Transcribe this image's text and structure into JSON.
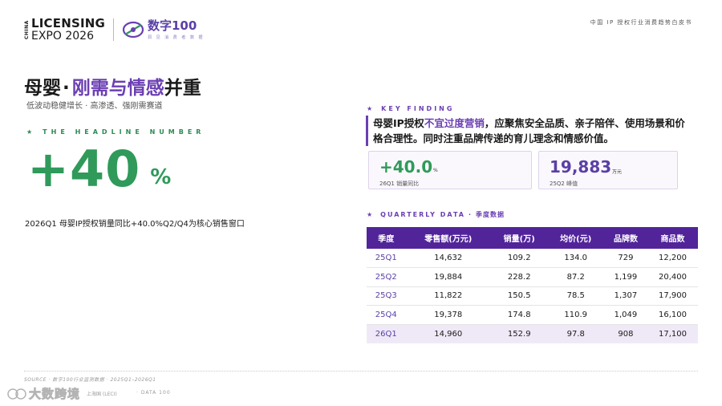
{
  "header": {
    "logo_vertical": "CHINA",
    "logo_line1": "LICENSING",
    "logo_line2": "EXPO 2026",
    "brand_name": "数字100",
    "brand_sub": "洞 见 消 费 者 数 据",
    "report_title": "中国 IP 授权行业消费趋势白皮书"
  },
  "title": {
    "prefix": "母婴",
    "dot": "·",
    "highlight": "刚需与情感",
    "suffix": "并重"
  },
  "subtitle": "低波动稳健增长  ·  高渗透、强刚需赛道",
  "headline": {
    "label_star": "★",
    "label": "THE HEADLINE NUMBER",
    "value": "+40",
    "unit": "%",
    "caption": "2026Q1  母婴IP授权销量同比+40.0%Q2/Q4为核心销售窗口"
  },
  "key_finding": {
    "label_star": "★",
    "label": "KEY FINDING",
    "text_part1": "母婴IP授权",
    "text_highlight": "不宜过度营销",
    "text_part2": "，应聚焦安全品质、亲子陪伴、使用场景和价格合理性。同时注重品牌传递的育儿理念和情感价值。"
  },
  "cards": [
    {
      "value": "+40.0",
      "unit": "%",
      "caption": "26Q1 销量同比"
    },
    {
      "value": "19,883",
      "unit": "万元",
      "caption": "25Q2 峰值"
    }
  ],
  "quarterly": {
    "label_star": "★",
    "label": "QUARTERLY DATA",
    "sep": "·",
    "label_cn": "季度数据",
    "headers": [
      "季度",
      "零售额(万元)",
      "销量(万)",
      "均价(元)",
      "品牌数",
      "商品数"
    ],
    "rows": [
      [
        "25Q1",
        "14,632",
        "109.2",
        "134.0",
        "729",
        "12,200"
      ],
      [
        "25Q2",
        "19,884",
        "228.2",
        "87.2",
        "1,199",
        "20,400"
      ],
      [
        "25Q3",
        "11,822",
        "150.5",
        "78.5",
        "1,307",
        "17,900"
      ],
      [
        "25Q4",
        "19,378",
        "174.8",
        "110.9",
        "1,049",
        "16,100"
      ],
      [
        "26Q1",
        "14,960",
        "152.9",
        "97.8",
        "908",
        "17,100"
      ]
    ]
  },
  "footer": {
    "source": "SOURCE · 数字100行业监测数据 · 2025Q1–2026Q1",
    "org": "上海国 (LECI)",
    "page": "·  DATA 100"
  },
  "watermark": "大数跨境",
  "colors": {
    "accent_purple": "#6b3fb3",
    "table_header": "#52249a",
    "accent_green": "#2f9a5a"
  }
}
